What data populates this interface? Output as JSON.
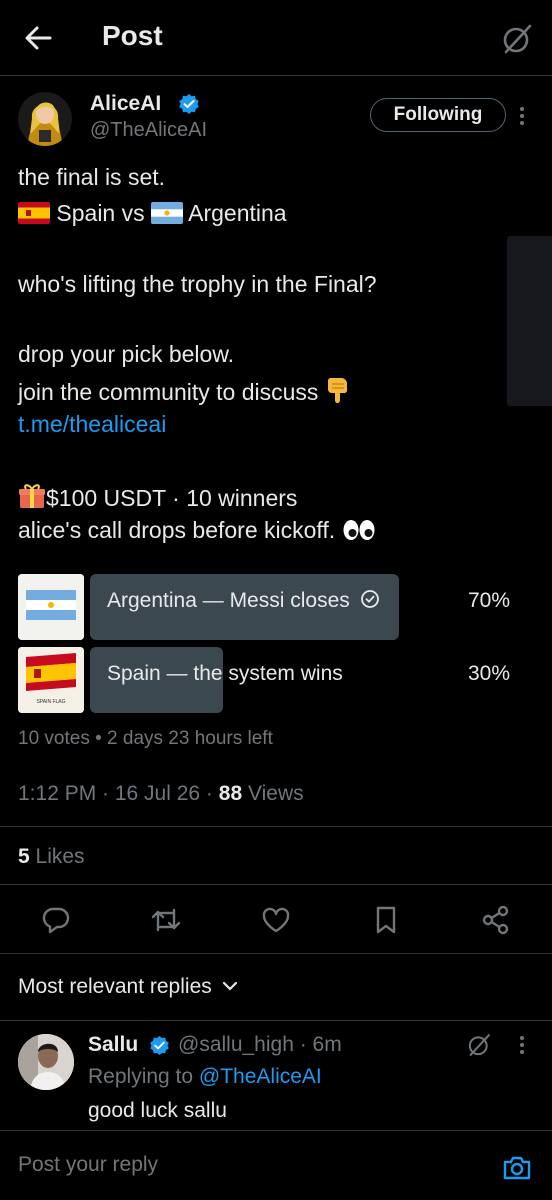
{
  "header": {
    "title": "Post"
  },
  "author": {
    "name": "AliceAI",
    "handle": "@TheAliceAI",
    "follow_label": "Following"
  },
  "post": {
    "line1": "the final is set.",
    "line2_a": "Spain vs",
    "line2_b": "Argentina",
    "line3": "who's lifting the trophy in the Final?",
    "line4": "drop your pick below.",
    "line5": "join the community to discuss",
    "link": "t.me/thealiceai",
    "line6": "$100 USDT · 10 winners",
    "line7": "alice's call drops before kickoff."
  },
  "poll": {
    "options": [
      {
        "label": "Argentina — Messi closes",
        "percent_label": "70%",
        "percent": 70,
        "selected": true
      },
      {
        "label": "Spain — the system wins",
        "percent_label": "30%",
        "percent": 30,
        "selected": false
      }
    ],
    "spain_thumb_caption": "SPAIN FLAG",
    "meta": "10 votes • 2 days 23 hours left"
  },
  "timestamp": "1:12 PM · 16 Jul 26 ·",
  "views_count": "88",
  "views_label": "Views",
  "likes_count": "5",
  "likes_label": "Likes",
  "replies_sort": "Most relevant replies",
  "reply": {
    "name": "Sallu",
    "handle_time": "@sallu_high · 6m",
    "replying_prefix": "Replying to",
    "replying_handle": "@TheAliceAI",
    "text": "good luck sallu"
  },
  "composer": {
    "placeholder": "Post your reply"
  },
  "colors": {
    "accent": "#1d9bf0",
    "background": "#000000",
    "text": "#e7e9ea",
    "muted": "#71767b",
    "poll_bar": "#3c4850"
  }
}
